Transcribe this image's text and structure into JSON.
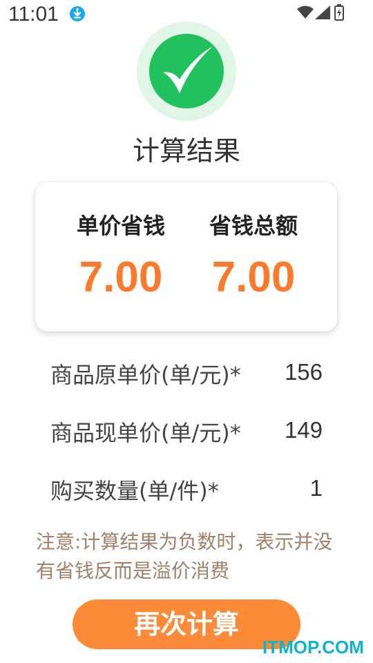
{
  "status_bar": {
    "time": "11:01",
    "icons": [
      "download-icon",
      "wifi-icon",
      "signal-icon",
      "battery-icon"
    ]
  },
  "result": {
    "icon": "check-icon",
    "title": "计算结果"
  },
  "summary": {
    "unit_saving_label": "单价省钱",
    "unit_saving_value": "7.00",
    "total_saving_label": "省钱总额",
    "total_saving_value": "7.00"
  },
  "details": [
    {
      "label": "商品原单价(单/元)*",
      "value": "156"
    },
    {
      "label": "商品现单价(单/元)*",
      "value": "149"
    },
    {
      "label": "购买数量(单/件)*",
      "value": "1"
    }
  ],
  "note": "注意:计算结果为负数时，表示并没有省钱反而是溢价消费",
  "actions": {
    "recalculate_label": "再次计算"
  },
  "watermark": "ITMOP.COM",
  "colors": {
    "accent_orange": "#fc8b39",
    "value_orange": "#fb7a2c",
    "check_green": "#21c25d",
    "check_halo": "#e1f6e7",
    "note_brown": "#a0806a",
    "watermark_teal": "#0fb4c8"
  }
}
